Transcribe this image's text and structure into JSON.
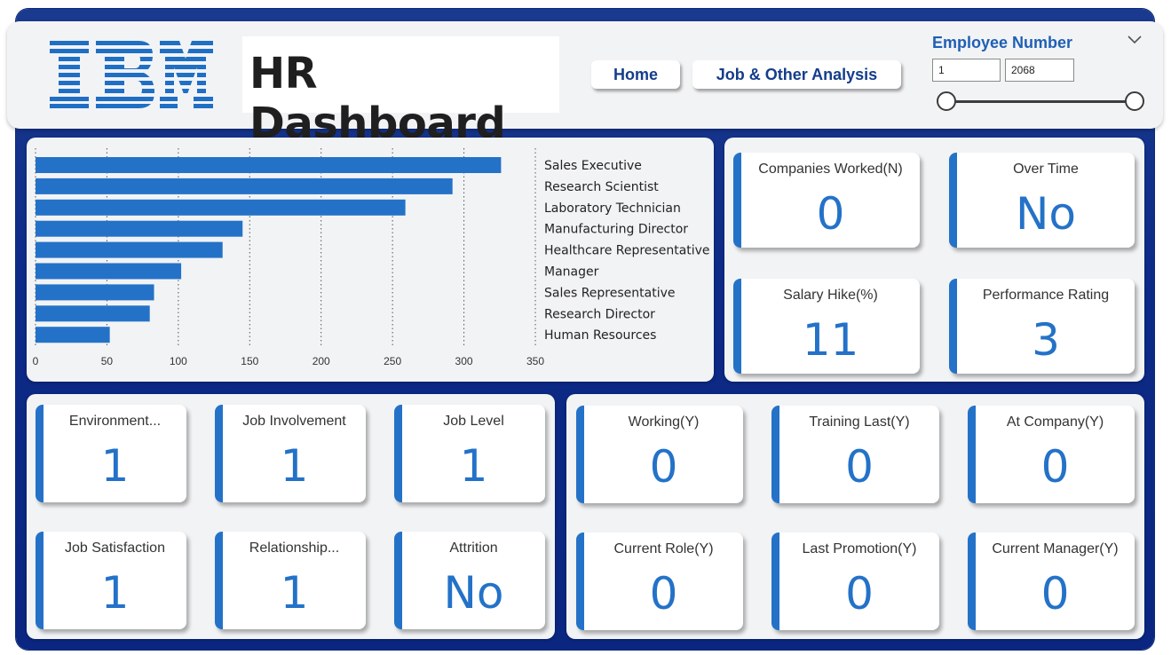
{
  "header": {
    "logo_text": "IBM",
    "title": "HR Dashboard",
    "nav": [
      {
        "label": "Home"
      },
      {
        "label": "Job & Other Analysis"
      }
    ]
  },
  "slicer": {
    "title": "Employee Number",
    "min_value": "1",
    "max_value": "2068",
    "range": [
      1,
      2068
    ]
  },
  "chart_data": {
    "type": "bar",
    "orientation": "horizontal",
    "categories": [
      "Sales Executive",
      "Research Scientist",
      "Laboratory Technician",
      "Manufacturing Director",
      "Healthcare Representative",
      "Manager",
      "Sales Representative",
      "Research Director",
      "Human Resources"
    ],
    "values": [
      326,
      292,
      259,
      145,
      131,
      102,
      83,
      80,
      52
    ],
    "xlim": [
      0,
      350
    ],
    "xticks": [
      "0",
      "50",
      "100",
      "150",
      "200",
      "250",
      "300",
      "350"
    ],
    "grid": "vertical dotted",
    "bar_color": "#2472c8"
  },
  "kpis_top": [
    {
      "label": "Companies Worked(N)",
      "value": "0"
    },
    {
      "label": "Over Time",
      "value": "No"
    },
    {
      "label": "Salary Hike(%)",
      "value": "11"
    },
    {
      "label": "Performance Rating",
      "value": "3"
    }
  ],
  "kpis_left": [
    {
      "label": "Environment...",
      "value": "1"
    },
    {
      "label": "Job Involvement",
      "value": "1"
    },
    {
      "label": "Job Level",
      "value": "1"
    },
    {
      "label": "Job Satisfaction",
      "value": "1"
    },
    {
      "label": "Relationship...",
      "value": "1"
    },
    {
      "label": "Attrition",
      "value": "No"
    }
  ],
  "kpis_right": [
    {
      "label": "Working(Y)",
      "value": "0"
    },
    {
      "label": "Training Last(Y)",
      "value": "0"
    },
    {
      "label": "At Company(Y)",
      "value": "0"
    },
    {
      "label": "Current Role(Y)",
      "value": "0"
    },
    {
      "label": "Last Promotion(Y)",
      "value": "0"
    },
    {
      "label": "Current Manager(Y)",
      "value": "0"
    }
  ],
  "colors": {
    "accent": "#2472c8",
    "frame": "#0c2a86",
    "panel": "#f2f3f5"
  }
}
